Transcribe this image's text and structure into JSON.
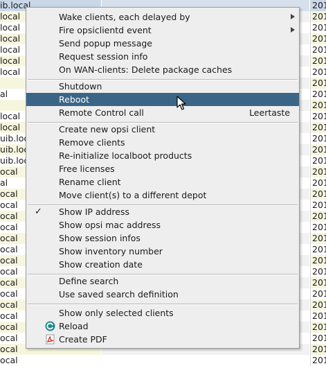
{
  "table": {
    "rows": [
      {
        "client": "ib.local",
        "date": "201"
      },
      {
        "client": "local",
        "date": "201"
      },
      {
        "client": "local",
        "date": "201"
      },
      {
        "client": "local",
        "date": "201"
      },
      {
        "client": "local",
        "date": "201"
      },
      {
        "client": "local",
        "date": "201"
      },
      {
        "client": "local",
        "date": "201"
      },
      {
        "client": "",
        "date": "201"
      },
      {
        "client": "al",
        "date": "201"
      },
      {
        "client": "",
        "date": "201"
      },
      {
        "client": "local",
        "date": "201"
      },
      {
        "client": "local",
        "date": "201"
      },
      {
        "client": "uib.local",
        "date": "201"
      },
      {
        "client": "uib.loc",
        "date": "201"
      },
      {
        "client": "uib.loc",
        "date": "201"
      },
      {
        "client": "ocal",
        "date": "201"
      },
      {
        "client": "al",
        "date": "201"
      },
      {
        "client": "ocal",
        "date": "201"
      },
      {
        "client": "ocal",
        "date": "201"
      },
      {
        "client": "ocal",
        "date": "201"
      },
      {
        "client": "ocal",
        "date": "201"
      },
      {
        "client": "ocal",
        "date": "201"
      },
      {
        "client": "ocal",
        "date": "201"
      },
      {
        "client": "ocal",
        "date": "201"
      },
      {
        "client": "ocal",
        "date": "201"
      },
      {
        "client": "ocal",
        "date": "201"
      },
      {
        "client": "ocal",
        "date": "201"
      },
      {
        "client": "ocal",
        "date": "201"
      },
      {
        "client": "ocal",
        "date": "201"
      },
      {
        "client": "ocal",
        "date": "201"
      },
      {
        "client": "ocal",
        "date": "201"
      },
      {
        "client": "ocal",
        "date": "201"
      },
      {
        "client": "ocal",
        "date": "201"
      }
    ]
  },
  "menu": {
    "group1": {
      "wake": "Wake clients, each delayed by",
      "fire_event": "Fire opsiclientd event",
      "popup": "Send popup message",
      "session": "Request session info",
      "wan_delete": "On WAN-clients: Delete package caches"
    },
    "group2": {
      "shutdown": "Shutdown",
      "reboot": "Reboot",
      "remote_control": "Remote Control call",
      "remote_control_shortcut": "Leertaste"
    },
    "group3": {
      "create_client": "Create new opsi client",
      "remove_clients": "Remove clients",
      "reinit_localboot": "Re-initialize localboot products",
      "free_licenses": "Free licenses",
      "rename_client": "Rename client",
      "move_depot": "Move client(s) to a different depot"
    },
    "group4": {
      "show_ip": "Show IP address",
      "show_ip_checked": "✓",
      "show_mac": "Show opsi mac address",
      "show_session": "Show session infos",
      "show_inventory": "Show inventory number",
      "show_creation": "Show creation date"
    },
    "group5": {
      "define_search": "Define search",
      "use_saved_search": "Use saved search definition"
    },
    "group6": {
      "show_selected": "Show only selected clients",
      "reload": "Reload",
      "create_pdf": "Create PDF"
    }
  },
  "icons": {
    "submenu": "chevron-right-icon",
    "reload": "reload-icon",
    "pdf": "pdf-icon",
    "cursor": "mouse-pointer-icon"
  },
  "colors": {
    "highlight": "#3b6586",
    "menu_bg": "#eeeeee",
    "row_alt": "#f6f6df",
    "selected_row": "#c9d7e7"
  }
}
